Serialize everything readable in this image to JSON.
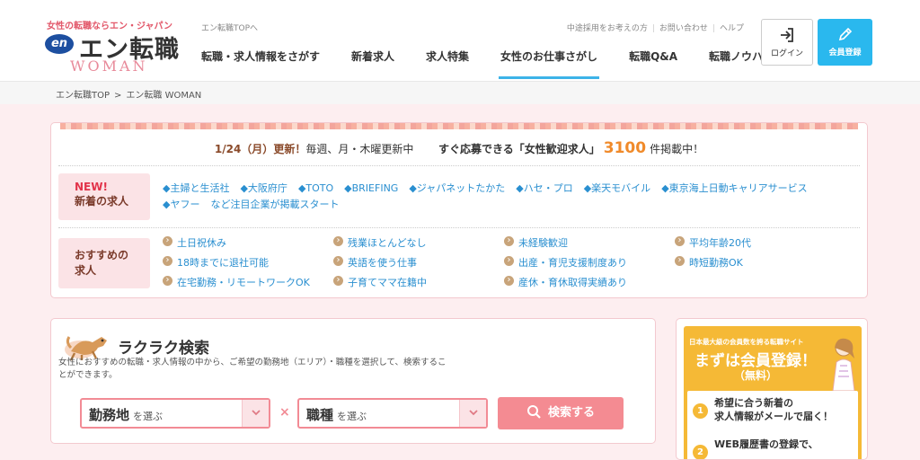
{
  "header": {
    "tagline": "女性の転職ならエン・ジャパン",
    "logo_mark": "en",
    "logo_text": "エン転職",
    "logo_sub": "WOMAN",
    "top_link": "エン転職TOPへ",
    "util_links": [
      "中途採用をお考えの方",
      "お問い合わせ",
      "ヘルプ"
    ],
    "nav": [
      {
        "label": "転職・求人情報をさがす",
        "active": false
      },
      {
        "label": "新着求人",
        "active": false
      },
      {
        "label": "求人特集",
        "active": false
      },
      {
        "label": "女性のお仕事さがし",
        "active": true
      },
      {
        "label": "転職Q&A",
        "active": false
      },
      {
        "label": "転職ノウハウ",
        "active": false
      }
    ],
    "login_label": "ログイン",
    "login_icon": "login-icon",
    "register_label": "会員登録",
    "register_icon": "pencil-icon"
  },
  "breadcrumb": [
    "エン転職TOP",
    "エン転職 WOMAN"
  ],
  "breadcrumb_sep": ">",
  "info": {
    "date": "1/24（月）",
    "updated": "更新！",
    "schedule": "毎週、月・木曜更新中",
    "apply_text": "すぐ応募できる「女性歓迎求人」",
    "count": "3100",
    "count_suffix": "件掲載中！",
    "new_tag_top": "NEW!",
    "new_tag_bottom": "新着の求人",
    "new_links": [
      "◆主婦と生活社",
      "◆大阪府庁",
      "◆TOTO",
      "◆BRIEFING",
      "◆ジャパネットたかた",
      "◆ハセ・プロ",
      "◆楽天モバイル",
      "◆東京海上日動キャリアサービス",
      "◆ヤフー"
    ],
    "new_tail": "など注目企業が掲載スタート",
    "rec_tag_top": "おすすめの",
    "rec_tag_bottom": "求人",
    "recommended": [
      "土日祝休み",
      "残業ほとんどなし",
      "未経験歓迎",
      "平均年齢20代",
      "18時までに退社可能",
      "英語を使う仕事",
      "出産・育児支援制度あり",
      "時短勤務OK",
      "在宅勤務・リモートワークOK",
      "子育てママ在籍中",
      "産休・育休取得実績あり"
    ]
  },
  "search": {
    "title": "ラクラク検索",
    "desc": "女性におすすめの転職・求人情報の中から、ご希望の勤務地（エリア）・職種を選択して、検索することができます。",
    "area_main": "勤務地",
    "area_sub": "を選ぶ",
    "job_main": "職種",
    "job_sub": "を選ぶ",
    "times": "×",
    "button_label": "検索する",
    "button_icon": "search-icon"
  },
  "side": {
    "small": "日本最大級の会員数を誇る転職サイト",
    "title": "まずは会員登録！",
    "free": "（無料）",
    "items": [
      {
        "num": "1",
        "line1": "希望に合う新着の",
        "line2": "求人情報がメールで届く！"
      },
      {
        "num": "2",
        "line1": "WEB履歴書の登録で、",
        "line2": ""
      }
    ]
  },
  "colors": {
    "brand_pink": "#e2586a",
    "accent_blue": "#2ab8ee",
    "nav_underline": "#3db3e8",
    "count_orange": "#f08a2a",
    "search_pink": "#f48b92",
    "side_yellow": "#f5b936"
  }
}
